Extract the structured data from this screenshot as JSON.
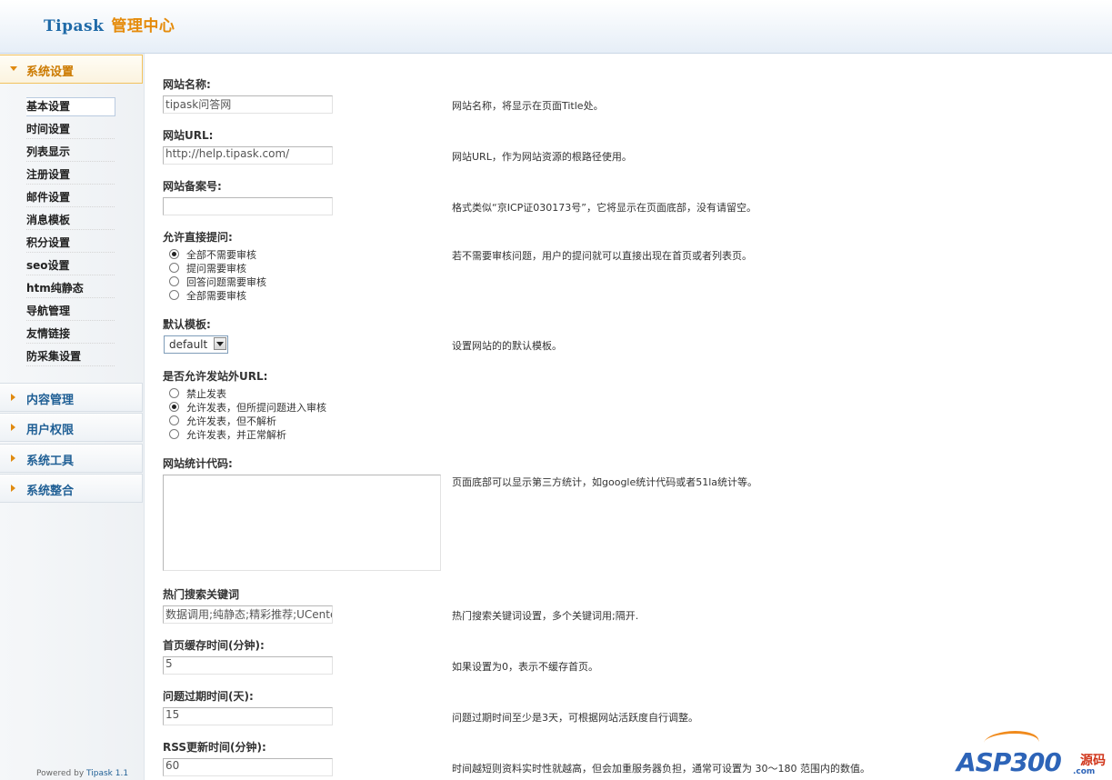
{
  "header": {
    "brand_en": "Tipask",
    "brand_cn": "管理中心"
  },
  "sidebar": {
    "sections": [
      {
        "label": "系统设置",
        "open": true
      },
      {
        "label": "内容管理",
        "open": false
      },
      {
        "label": "用户权限",
        "open": false
      },
      {
        "label": "系统工具",
        "open": false
      },
      {
        "label": "系统整合",
        "open": false
      }
    ],
    "items": [
      "基本设置",
      "时间设置",
      "列表显示",
      "注册设置",
      "邮件设置",
      "消息模板",
      "积分设置",
      "seo设置",
      "htm纯静态",
      "导航管理",
      "友情链接",
      "防采集设置"
    ],
    "active_item": "基本设置"
  },
  "form": {
    "site_name": {
      "label": "网站名称:",
      "value": "tipask问答网",
      "help": "网站名称，将显示在页面Title处。"
    },
    "site_url": {
      "label": "网站URL:",
      "value": "http://help.tipask.com/",
      "help": "网站URL，作为网站资源的根路径使用。"
    },
    "icp": {
      "label": "网站备案号:",
      "value": "",
      "help": "格式类似“京ICP证030173号”，它将显示在页面底部，没有请留空。"
    },
    "allow_ask": {
      "label": "允许直接提问:",
      "options": [
        "全部不需要审核",
        "提问需要审核",
        "回答问题需要审核",
        "全部需要审核"
      ],
      "selected": "全部不需要审核",
      "help": "若不需要审核问题，用户的提问就可以直接出现在首页或者列表页。"
    },
    "template": {
      "label": "默认模板:",
      "value": "default",
      "help": "设置网站的的默认模板。"
    },
    "external_url": {
      "label": "是否允许发站外URL:",
      "options": [
        "禁止发表",
        "允许发表，但所提问题进入审核",
        "允许发表，但不解析",
        "允许发表，并正常解析"
      ],
      "selected": "允许发表，但所提问题进入审核"
    },
    "stats_code": {
      "label": "网站统计代码:",
      "value": "",
      "help": "页面底部可以显示第三方统计，如google统计代码或者51la统计等。"
    },
    "hot_keywords": {
      "label": "热门搜索关键词",
      "value": "数据调用;纯静态;精彩推荐;UCenter",
      "help": "热门搜索关键词设置，多个关键词用;隔开."
    },
    "index_cache": {
      "label": "首页缓存时间(分钟):",
      "value": "5",
      "help": "如果设置为0，表示不缓存首页。"
    },
    "question_expire": {
      "label": "问题过期时间(天):",
      "value": "15",
      "help": "问题过期时间至少是3天，可根据网站活跃度自行调整。"
    },
    "rss_update": {
      "label": "RSS更新时间(分钟):",
      "value": "60",
      "help": "时间越短则资料实时性就越高，但会加重服务器负担，通常可设置为 30～180 范围内的数值。"
    }
  },
  "footer": {
    "powered": "Powered by",
    "product": "Tipask 1.1"
  },
  "watermark": {
    "brand": "ASP300",
    "suffix": "源码",
    "domain": ".com"
  }
}
